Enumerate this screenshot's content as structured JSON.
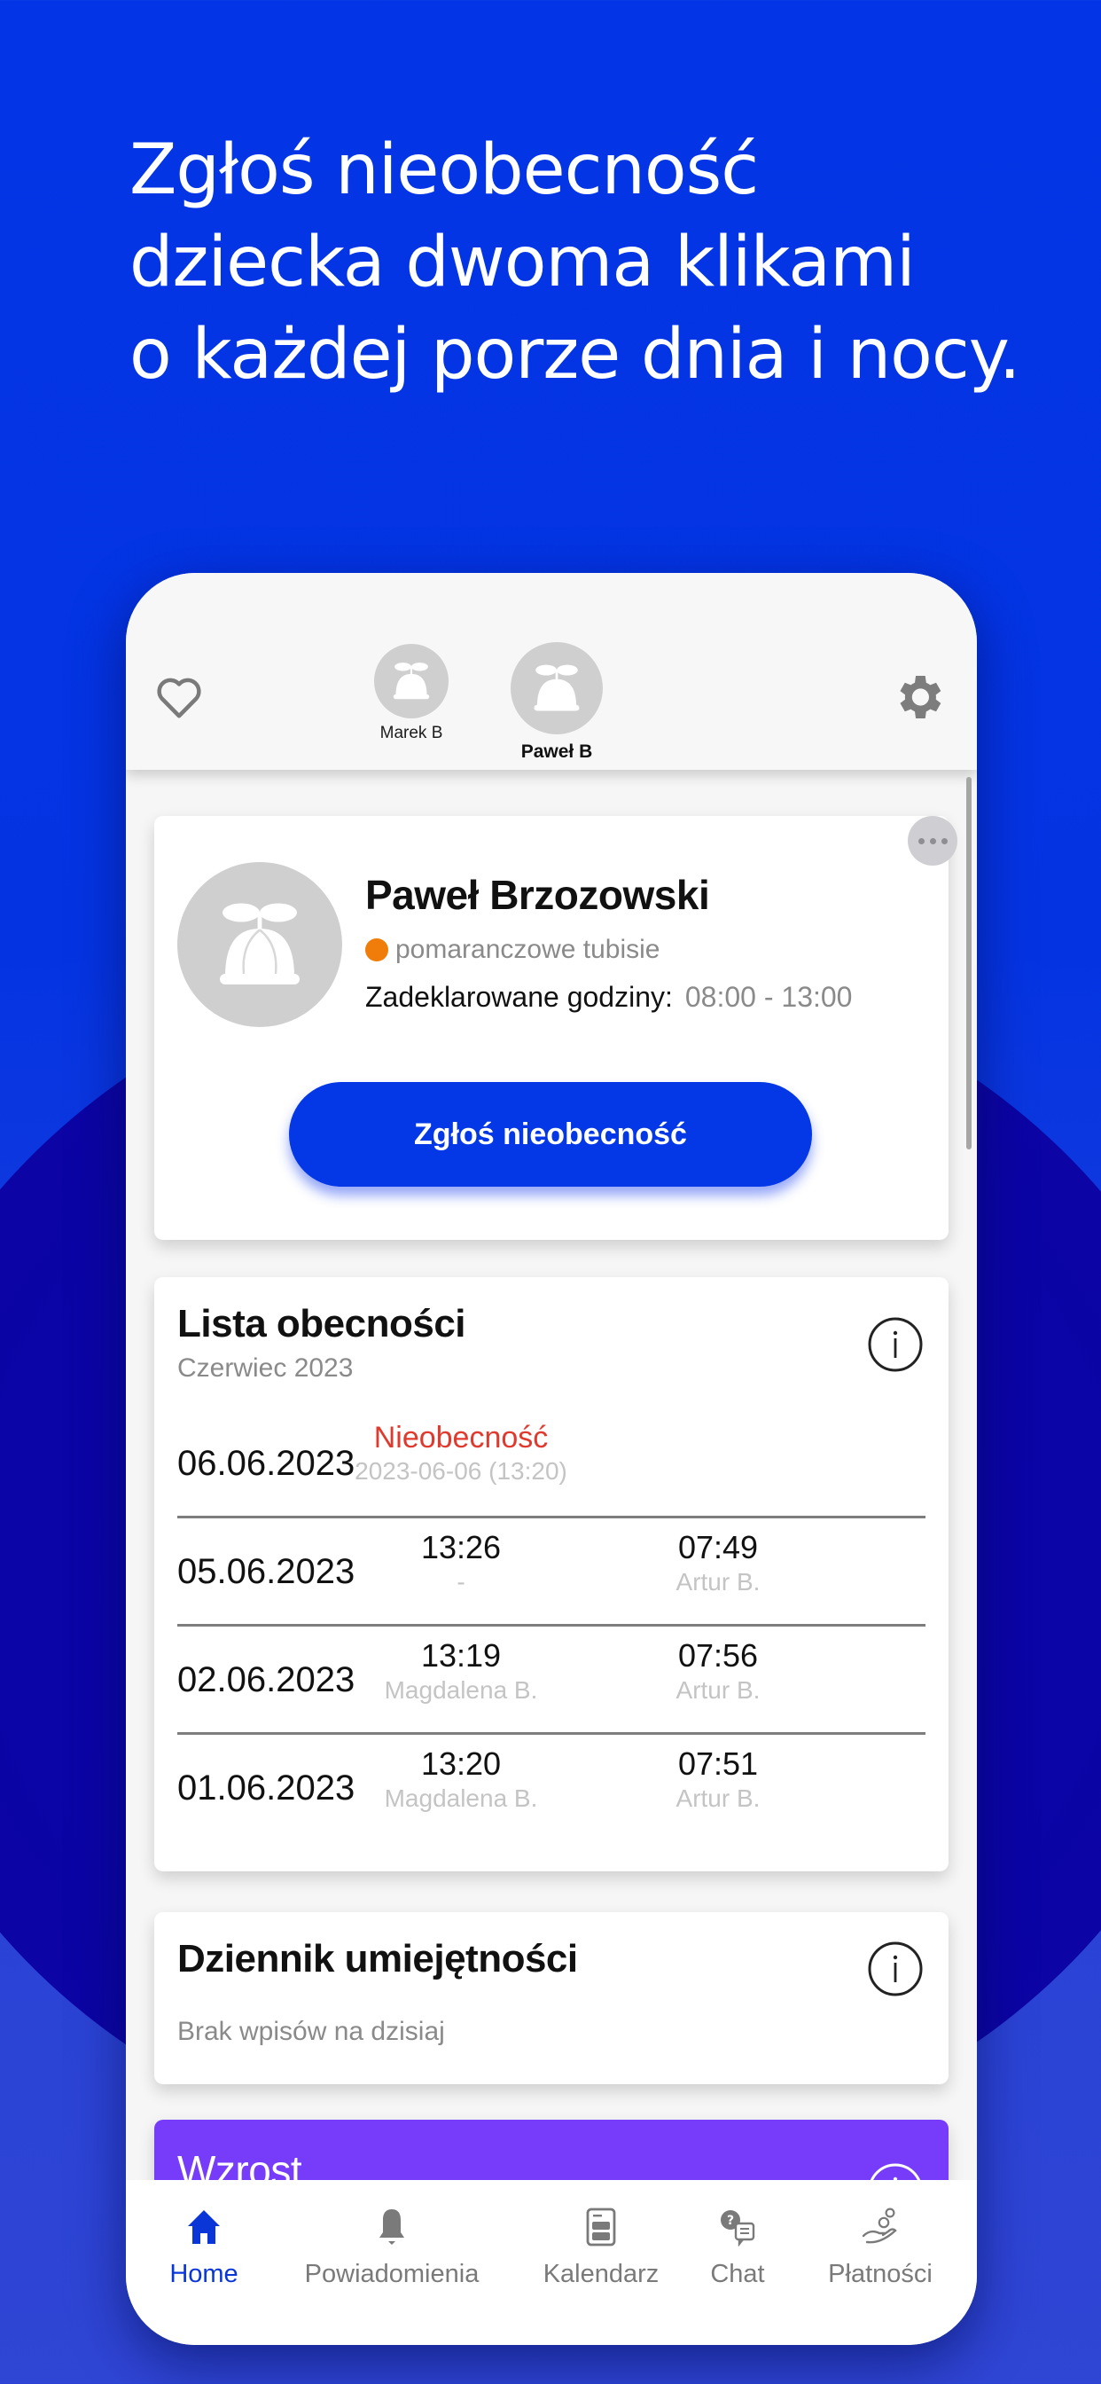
{
  "promo": {
    "headline_lines": [
      "Zgłoś nieobecność",
      "dziecka dwoma klikami",
      "o każdej porze dnia i nocy."
    ]
  },
  "colors": {
    "brand_blue": "#0437e6",
    "absence_red": "#e03a2e",
    "group_orange": "#f07d0a",
    "growth_purple": "#763cfa",
    "tab_active": "#0a36d8"
  },
  "header": {
    "favorites_icon": "heart-icon",
    "settings_icon": "gear-icon",
    "children": [
      {
        "name": "Marek B",
        "selected": false,
        "avatar_icon": "propeller-hat-icon"
      },
      {
        "name": "Paweł B",
        "selected": true,
        "avatar_icon": "propeller-hat-icon"
      }
    ]
  },
  "child_card": {
    "more_icon": "more-dots-icon",
    "full_name": "Paweł Brzozowski",
    "group": "pomaranczowe tubisie",
    "declared_hours_label": "Zadeklarowane godziny:",
    "declared_hours_value": "08:00 - 13:00",
    "report_absence_button": "Zgłoś nieobecność"
  },
  "attendance": {
    "title": "Lista obecności",
    "month": "Czerwiec 2023",
    "rows": [
      {
        "date": "06.06.2023",
        "status": "Nieobecność",
        "status_detail": "2023-06-06 (13:20)",
        "type": "absence"
      },
      {
        "date": "05.06.2023",
        "pickup_time": "13:26",
        "pickup_by": "-",
        "dropoff_time": "07:49",
        "dropoff_by": "Artur B.",
        "type": "present"
      },
      {
        "date": "02.06.2023",
        "pickup_time": "13:19",
        "pickup_by": "Magdalena B.",
        "dropoff_time": "07:56",
        "dropoff_by": "Artur B.",
        "type": "present"
      },
      {
        "date": "01.06.2023",
        "pickup_time": "13:20",
        "pickup_by": "Magdalena B.",
        "dropoff_time": "07:51",
        "dropoff_by": "Artur B.",
        "type": "present"
      }
    ]
  },
  "skills": {
    "title": "Dziennik umiejętności",
    "empty_text": "Brak wpisów na dzisiaj"
  },
  "growth": {
    "title": "Wzrost"
  },
  "tabbar": {
    "items": [
      {
        "label": "Home",
        "icon": "home-icon",
        "active": true
      },
      {
        "label": "Powiadomienia",
        "icon": "bell-icon",
        "active": false
      },
      {
        "label": "Kalendarz",
        "icon": "calendar-icon",
        "active": false
      },
      {
        "label": "Chat",
        "icon": "chat-icon",
        "active": false
      },
      {
        "label": "Płatności",
        "icon": "payments-icon",
        "active": false
      }
    ]
  }
}
